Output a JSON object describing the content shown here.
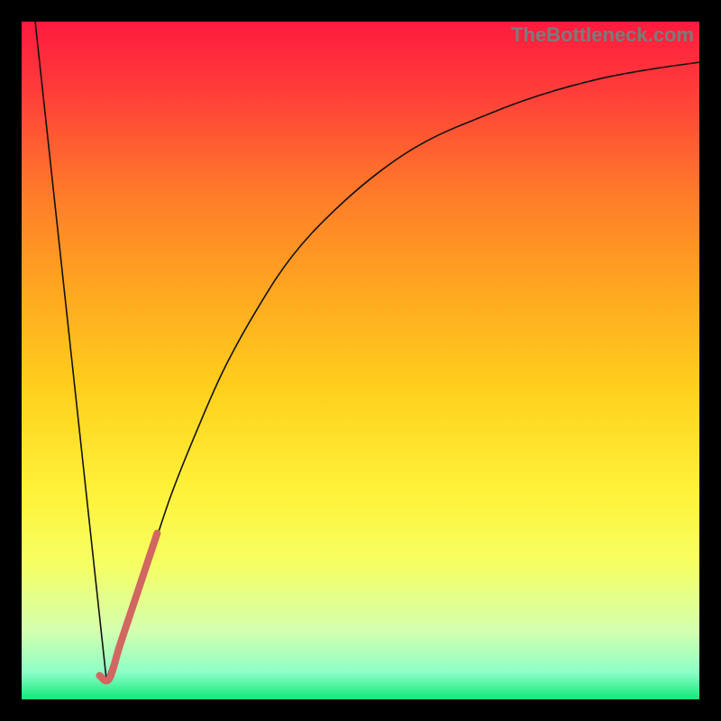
{
  "watermark": {
    "text": "TheBottleneck.com",
    "color": "#7b7b7b"
  },
  "chart_data": {
    "type": "line",
    "title": "",
    "xlabel": "",
    "ylabel": "",
    "xlim": [
      0,
      100
    ],
    "ylim": [
      0,
      100
    ],
    "gradient_stops": [
      {
        "t": 0.0,
        "color": "#ff1a3e"
      },
      {
        "t": 0.1,
        "color": "#ff3c3a"
      },
      {
        "t": 0.25,
        "color": "#ff7a2a"
      },
      {
        "t": 0.4,
        "color": "#ffa820"
      },
      {
        "t": 0.55,
        "color": "#ffd21d"
      },
      {
        "t": 0.7,
        "color": "#fff33b"
      },
      {
        "t": 0.8,
        "color": "#f6ff63"
      },
      {
        "t": 0.9,
        "color": "#d3ffb0"
      },
      {
        "t": 0.96,
        "color": "#8dffc6"
      },
      {
        "t": 1.0,
        "color": "#12e87a"
      }
    ],
    "series": [
      {
        "name": "left-line",
        "stroke": "#111111",
        "width": 1.6,
        "points": [
          {
            "x": 2.0,
            "y": 100.0
          },
          {
            "x": 12.5,
            "y": 3.0
          }
        ]
      },
      {
        "name": "right-curve",
        "stroke": "#111111",
        "width": 1.6,
        "points": [
          {
            "x": 12.5,
            "y": 3.0
          },
          {
            "x": 15.0,
            "y": 10.0
          },
          {
            "x": 18.0,
            "y": 18.0
          },
          {
            "x": 22.0,
            "y": 30.0
          },
          {
            "x": 26.0,
            "y": 40.0
          },
          {
            "x": 30.0,
            "y": 49.0
          },
          {
            "x": 35.0,
            "y": 58.0
          },
          {
            "x": 40.0,
            "y": 65.5
          },
          {
            "x": 46.0,
            "y": 72.0
          },
          {
            "x": 53.0,
            "y": 78.0
          },
          {
            "x": 60.0,
            "y": 82.5
          },
          {
            "x": 68.0,
            "y": 86.0
          },
          {
            "x": 76.0,
            "y": 89.0
          },
          {
            "x": 85.0,
            "y": 91.5
          },
          {
            "x": 93.0,
            "y": 93.0
          },
          {
            "x": 100.0,
            "y": 94.0
          }
        ]
      },
      {
        "name": "highlight-segment",
        "stroke": "#d26660",
        "width": 8,
        "linecap": "round",
        "points": [
          {
            "x": 11.5,
            "y": 3.5
          },
          {
            "x": 12.9,
            "y": 3.0
          },
          {
            "x": 14.5,
            "y": 8.0
          },
          {
            "x": 16.5,
            "y": 14.0
          },
          {
            "x": 18.5,
            "y": 20.0
          },
          {
            "x": 20.0,
            "y": 24.5
          }
        ]
      }
    ]
  }
}
